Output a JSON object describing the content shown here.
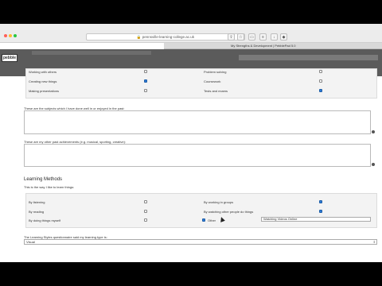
{
  "browser": {
    "url": "🔒 pennsville-learning-college.ac.uk",
    "tab_title": "My Strengths & Development | PebblePad 5.0"
  },
  "app": {
    "logo_text": "pebble"
  },
  "skills": {
    "left": [
      {
        "label": "Working with others",
        "checked": false
      },
      {
        "label": "Creating new things",
        "checked": true
      },
      {
        "label": "Making presentations",
        "checked": false
      }
    ],
    "right": [
      {
        "label": "Problem solving",
        "checked": false
      },
      {
        "label": "Coursework",
        "checked": false
      },
      {
        "label": "Tests and exams",
        "checked": true
      }
    ]
  },
  "subjects_prompt": "These are the subjects which I have done well in or enjoyed in the past:",
  "achievements_prompt": "These are my other past achievements (e.g. musical, sporting, creative):",
  "learning": {
    "title": "Learning Methods",
    "subtitle": "This is the way I like to learn things:",
    "left": [
      {
        "label": "By listening",
        "checked": false
      },
      {
        "label": "By reading",
        "checked": false
      },
      {
        "label": "By doing things myself",
        "checked": false
      }
    ],
    "right": [
      {
        "label": "By working in groups",
        "checked": true
      },
      {
        "label": "By watching other people do things",
        "checked": true
      },
      {
        "label": "Other",
        "checked": true
      }
    ],
    "other_value": "Watching Videos Online"
  },
  "styles": {
    "prompt": "The Learning Styles questionnaire said my learning type is:",
    "selected": "Visual"
  }
}
